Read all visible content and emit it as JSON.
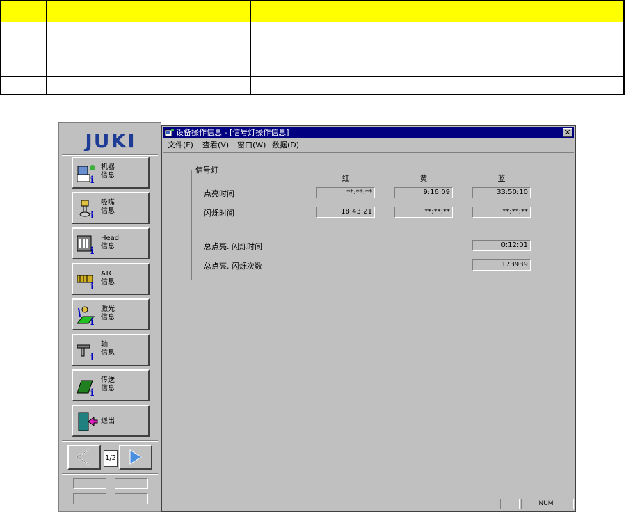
{
  "top_table": {
    "rows": 5,
    "cols": 3
  },
  "sidebar": {
    "logo_text": "JUKI",
    "buttons": [
      {
        "l1": "机器",
        "l2": "信息",
        "icon": "machine-info-icon"
      },
      {
        "l1": "吸嘴",
        "l2": "信息",
        "icon": "nozzle-info-icon"
      },
      {
        "l1": "Head",
        "l2": "信息",
        "icon": "head-info-icon"
      },
      {
        "l1": "ATC",
        "l2": "信息",
        "icon": "atc-info-icon"
      },
      {
        "l1": "激光",
        "l2": "信息",
        "icon": "laser-info-icon"
      },
      {
        "l1": "轴",
        "l2": "信息",
        "icon": "axis-info-icon"
      },
      {
        "l1": "传送",
        "l2": "信息",
        "icon": "conveyor-info-icon"
      },
      {
        "l1": "退出",
        "l2": "",
        "icon": "exit-icon"
      }
    ],
    "page_indicator": "1/2"
  },
  "window": {
    "title": "设备操作信息 - [信号灯操作信息]",
    "menu": [
      "文件(F)",
      "查看(V)",
      "窗口(W)",
      "数据(D)"
    ],
    "status": [
      "",
      "",
      "NUM",
      ""
    ]
  },
  "signal": {
    "group_title": "信号灯",
    "col_red": "红",
    "col_yellow": "黄",
    "col_blue": "蓝",
    "row_on_label": "点亮时间",
    "row_flash_label": "闪烁时间",
    "on_red": "**:**:**",
    "on_yellow": "9:16:09",
    "on_blue": "33:50:10",
    "flash_red": "18:43:21",
    "flash_yellow": "**:**:**",
    "flash_blue": "**:**:**",
    "total_time_label": "总点亮. 闪烁时间",
    "total_time_value": "0:12:01",
    "total_count_label": "总点亮. 闪烁次数",
    "total_count_value": "173939"
  },
  "colors": {
    "header_yellow": "#ffff00",
    "title_blue": "#000080",
    "juki_blue": "#1e3c96"
  }
}
